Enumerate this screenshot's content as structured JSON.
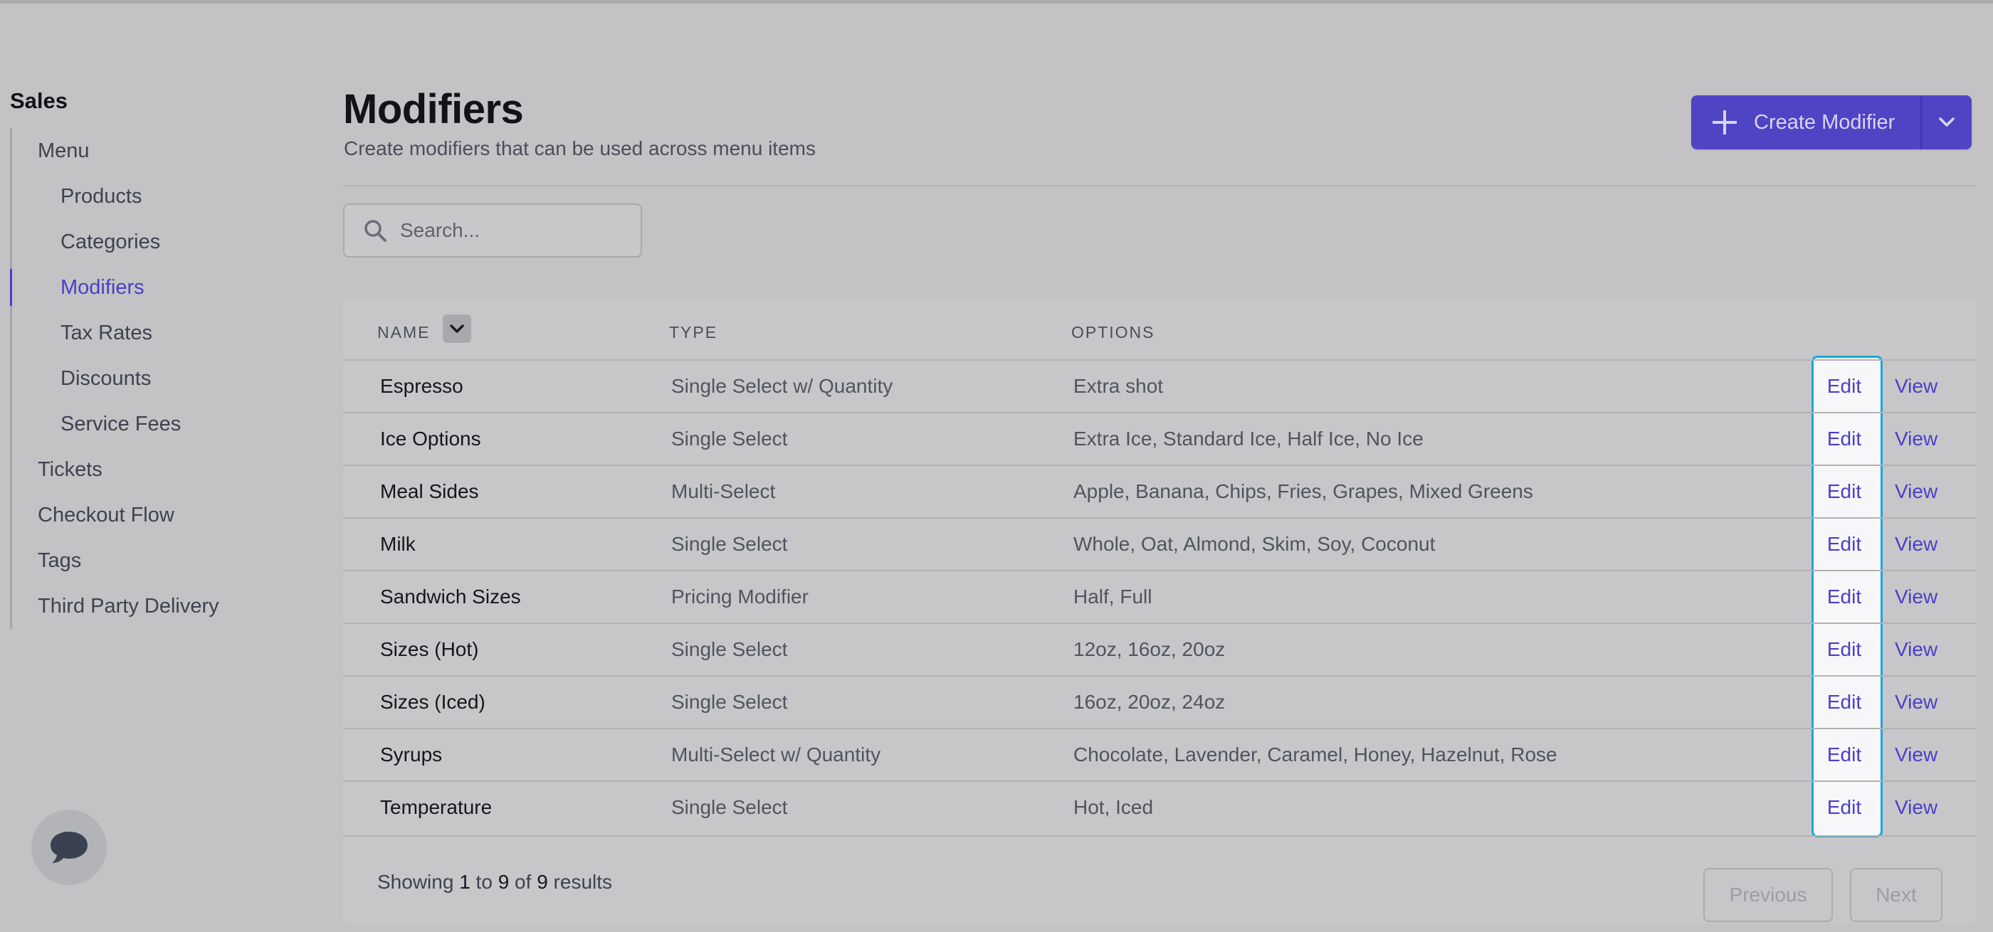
{
  "sidebar": {
    "title": "Sales",
    "items": [
      {
        "label": "Menu",
        "level": 0,
        "active": false
      },
      {
        "label": "Products",
        "level": 1,
        "active": false
      },
      {
        "label": "Categories",
        "level": 1,
        "active": false
      },
      {
        "label": "Modifiers",
        "level": 1,
        "active": true
      },
      {
        "label": "Tax Rates",
        "level": 1,
        "active": false
      },
      {
        "label": "Discounts",
        "level": 1,
        "active": false
      },
      {
        "label": "Service Fees",
        "level": 1,
        "active": false
      },
      {
        "label": "Tickets",
        "level": 0,
        "active": false
      },
      {
        "label": "Checkout Flow",
        "level": 0,
        "active": false
      },
      {
        "label": "Tags",
        "level": 0,
        "active": false
      },
      {
        "label": "Third Party Delivery",
        "level": 0,
        "active": false
      }
    ]
  },
  "header": {
    "title": "Modifiers",
    "subtitle": "Create modifiers that can be used across menu items",
    "create_label": "Create Modifier",
    "create_icon": "plus-icon",
    "caret_icon": "chevron-down-icon"
  },
  "search": {
    "placeholder": "Search...",
    "icon": "search-icon"
  },
  "table": {
    "columns": [
      "NAME",
      "TYPE",
      "OPTIONS"
    ],
    "sort_icon": "chevron-down-icon",
    "rows": [
      {
        "name": "Espresso",
        "type": "Single Select w/ Quantity",
        "options": "Extra shot",
        "edit": "Edit",
        "view": "View"
      },
      {
        "name": "Ice Options",
        "type": "Single Select",
        "options": "Extra Ice, Standard Ice, Half Ice, No Ice",
        "edit": "Edit",
        "view": "View"
      },
      {
        "name": "Meal Sides",
        "type": "Multi-Select",
        "options": "Apple, Banana, Chips, Fries, Grapes, Mixed Greens",
        "edit": "Edit",
        "view": "View"
      },
      {
        "name": "Milk",
        "type": "Single Select",
        "options": "Whole, Oat, Almond, Skim, Soy, Coconut",
        "edit": "Edit",
        "view": "View"
      },
      {
        "name": "Sandwich Sizes",
        "type": "Pricing Modifier",
        "options": "Half, Full",
        "edit": "Edit",
        "view": "View"
      },
      {
        "name": "Sizes (Hot)",
        "type": "Single Select",
        "options": "12oz, 16oz, 20oz",
        "edit": "Edit",
        "view": "View"
      },
      {
        "name": "Sizes (Iced)",
        "type": "Single Select",
        "options": "16oz, 20oz, 24oz",
        "edit": "Edit",
        "view": "View"
      },
      {
        "name": "Syrups",
        "type": "Multi-Select w/ Quantity",
        "options": "Chocolate, Lavender, Caramel, Honey, Hazelnut, Rose",
        "edit": "Edit",
        "view": "View"
      },
      {
        "name": "Temperature",
        "type": "Single Select",
        "options": "Hot, Iced",
        "edit": "Edit",
        "view": "View"
      }
    ]
  },
  "pagination": {
    "showing_prefix": "Showing",
    "from": "1",
    "to_word": "to",
    "to": "9",
    "of_word": "of",
    "total": "9",
    "suffix": "results",
    "previous_label": "Previous",
    "next_label": "Next"
  },
  "chat": {
    "icon": "chat-bubble-icon"
  },
  "colors": {
    "accent": "#4f44c4",
    "link": "#4b3fc8",
    "highlight_border": "#1aa7d6"
  }
}
